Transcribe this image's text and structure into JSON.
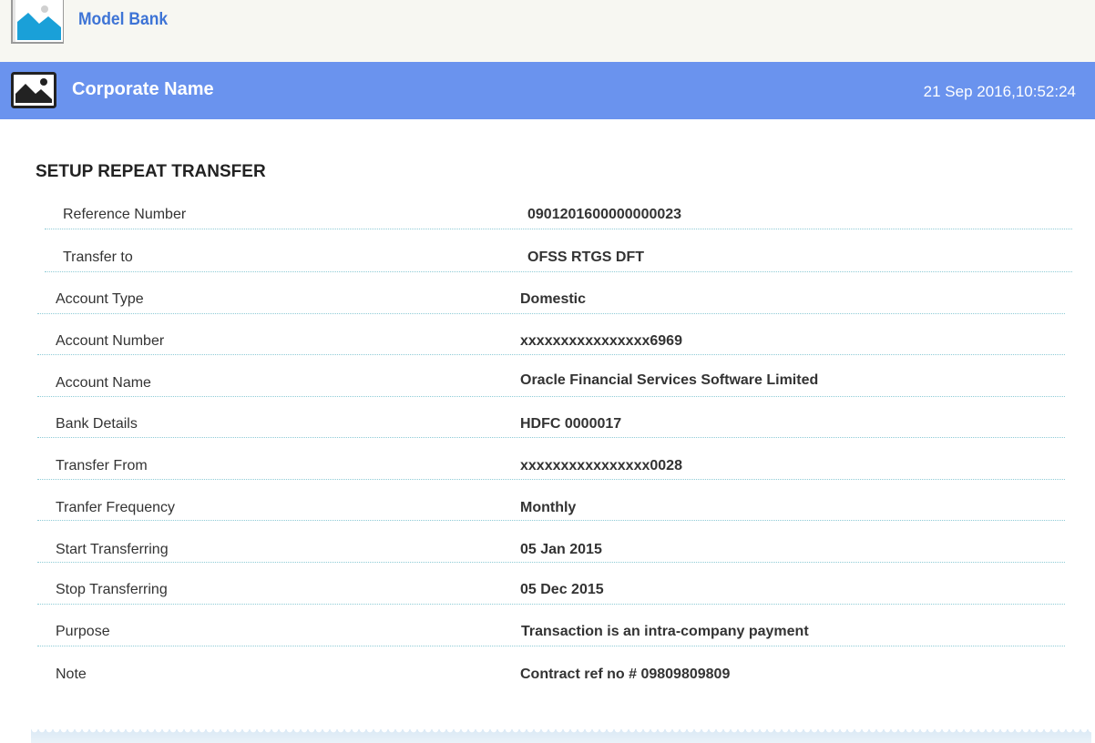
{
  "header": {
    "bank_name": "Model Bank",
    "corporate_name": "Corporate Name",
    "datetime": "21 Sep 2016,10:52:24"
  },
  "page": {
    "title": "SETUP REPEAT TRANSFER"
  },
  "details": [
    {
      "label": "Reference Number",
      "value": "0901201600000000023"
    },
    {
      "label": "Transfer to",
      "value": "OFSS RTGS DFT"
    },
    {
      "label": "Account Type",
      "value": "Domestic"
    },
    {
      "label": "Account Number",
      "value": "xxxxxxxxxxxxxxxx6969"
    },
    {
      "label": "Account Name",
      "value": "Oracle Financial Services Software Limited"
    },
    {
      "label": "Bank Details",
      "value": "HDFC 0000017"
    },
    {
      "label": "Transfer From",
      "value": "xxxxxxxxxxxxxxxx0028"
    },
    {
      "label": "Tranfer Frequency",
      "value": "Monthly"
    },
    {
      "label": "Start Transferring",
      "value": "05 Jan 2015"
    },
    {
      "label": "Stop Transferring",
      "value": "05 Dec 2015"
    },
    {
      "label": "Purpose",
      "value": "Transaction is an intra-company payment"
    },
    {
      "label": "Note",
      "value": "Contract ref no # 09809809809"
    }
  ],
  "icons": {
    "bank_logo": "image-placeholder-icon",
    "corporate_logo": "image-placeholder-icon"
  },
  "colors": {
    "brand_blue": "#3e74d6",
    "header_bar": "#6a93ee",
    "divider": "#8ecbd6"
  }
}
